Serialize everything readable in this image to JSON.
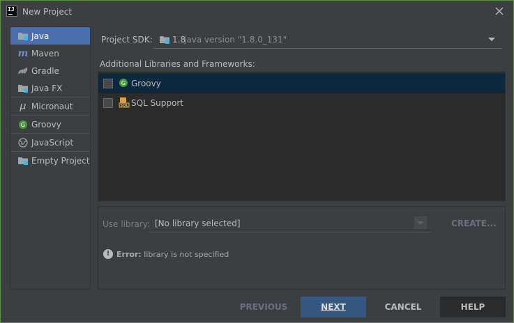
{
  "window": {
    "title": "New Project",
    "app_icon_text": "IJ"
  },
  "sidebar": {
    "items": [
      {
        "label": "Java",
        "icon": "folder-icon",
        "selected": true
      },
      {
        "label": "Maven",
        "icon": "maven-icon"
      },
      {
        "label": "Gradle",
        "icon": "gradle-icon"
      },
      {
        "label": "Java FX",
        "icon": "folder-icon"
      },
      {
        "label": "Micronaut",
        "icon": "micronaut-icon"
      },
      {
        "label": "Groovy",
        "icon": "groovy-icon"
      },
      {
        "label": "JavaScript",
        "icon": "globe-icon"
      },
      {
        "label": "Empty Project",
        "icon": "folder-icon"
      }
    ]
  },
  "sdk": {
    "label": "Project SDK:",
    "version": "1.8",
    "detail": "java version \"1.8.0_131\""
  },
  "libraries": {
    "label": "Additional Libraries and Frameworks:",
    "items": [
      {
        "label": "Groovy",
        "icon": "groovy-icon",
        "checked": false,
        "selected": true
      },
      {
        "label": "SQL Support",
        "icon": "sql-icon",
        "checked": false,
        "selected": false
      }
    ]
  },
  "library_config": {
    "use_library_label": "Use library:",
    "selected_value": "[No library selected]",
    "create_label": "CREATE...",
    "error_title": "Error:",
    "error_message": "library is not specified"
  },
  "buttons": {
    "previous": "PREVIOUS",
    "next": "NEXT",
    "cancel": "CANCEL",
    "help": "HELP"
  },
  "colors": {
    "selection": "#4b6eaf",
    "primary_button": "#365880",
    "list_selection": "#0d293e",
    "background": "#3c3f41"
  }
}
